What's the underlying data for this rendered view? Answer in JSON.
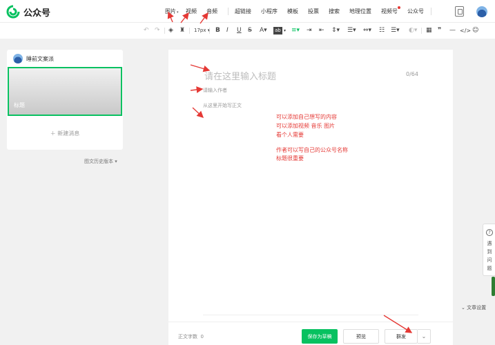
{
  "brand": {
    "name": "公众号",
    "color": "#07c160"
  },
  "top_menu": {
    "image": "图片",
    "video": "视频",
    "audio": "音频",
    "hyperlink": "超链接",
    "mini_program": "小程序",
    "template": "模板",
    "vote": "投票",
    "search": "搜索",
    "location": "地理位置",
    "channels": "视频号",
    "official_account": "公众号"
  },
  "toolbar": {
    "font_size": "17px",
    "bg_label": "ab"
  },
  "sidebar": {
    "account_name": "睡前文案派",
    "cover_title": "标题",
    "new_message": "新建消息",
    "history": "图文历史版本"
  },
  "editor": {
    "title_placeholder": "请在这里输入标题",
    "title_counter": "0/64",
    "author_placeholder": "请输入作者",
    "body_placeholder": "从这里开始写正文",
    "annotations": [
      "可以添加自己想写的内容",
      "可以添加视频 音乐 图片",
      "看个人需要",
      "作者可以写自己的公众号名称",
      "标题很重要"
    ]
  },
  "footer": {
    "word_count_label": "正文字数",
    "word_count": "0",
    "save_draft": "保存为草稿",
    "preview": "预览",
    "publish": "群发"
  },
  "help": {
    "text": "遇到问题"
  },
  "settings": {
    "label": "文章设置"
  },
  "colors": {
    "accent": "#07c160",
    "annotation": "#e53935",
    "channels_dot": "#e53935"
  }
}
